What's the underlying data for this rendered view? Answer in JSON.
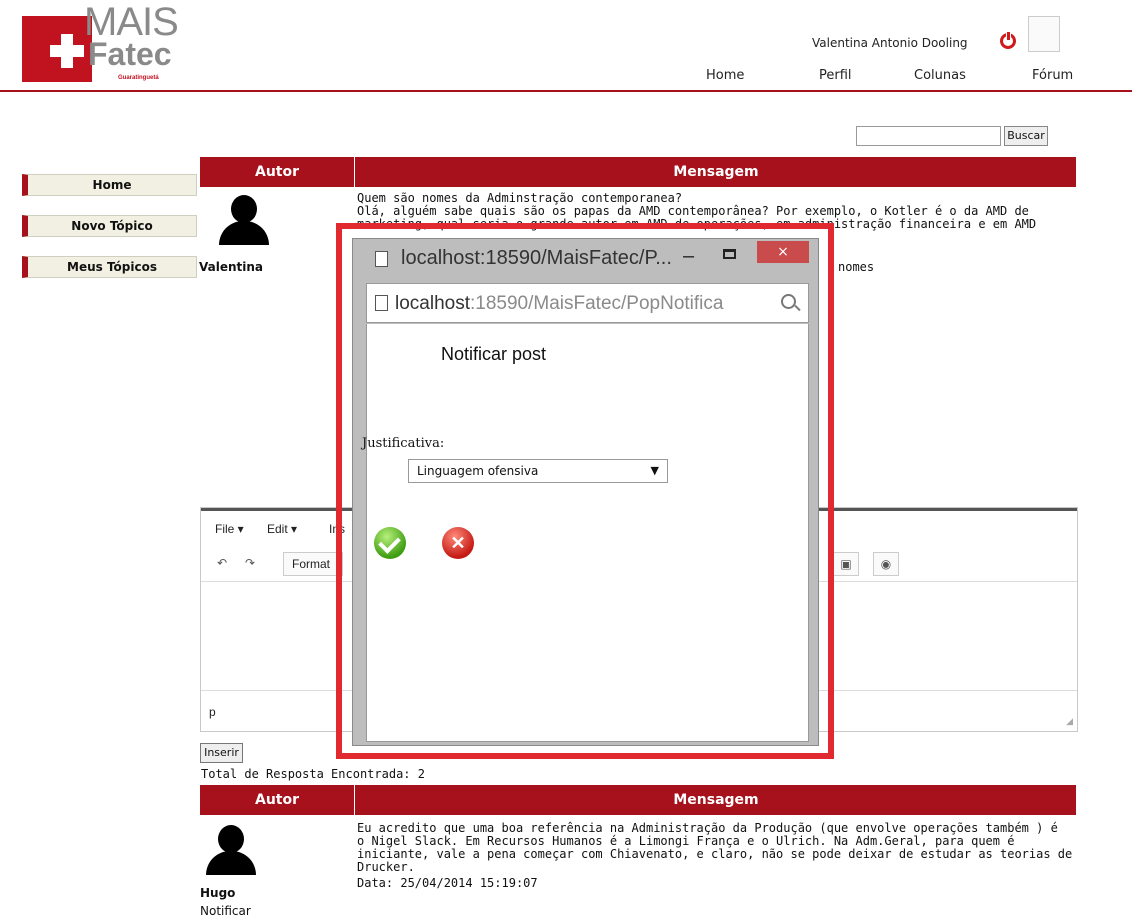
{
  "logo": {
    "mais": "MAIS",
    "fatec": "Fatec",
    "sub": "Guaratinguetá"
  },
  "user": {
    "name": "Valentina Antonio Dooling"
  },
  "nav": {
    "home": "Home",
    "perfil": "Perfil",
    "colunas": "Colunas",
    "forum": "Fórum"
  },
  "search": {
    "value": "",
    "button": "Buscar"
  },
  "sidebar": {
    "items": [
      {
        "label": "Home"
      },
      {
        "label": "Novo Tópico"
      },
      {
        "label": "Meus Tópicos"
      }
    ]
  },
  "table": {
    "author_header": "Autor",
    "message_header": "Mensagem"
  },
  "topic": {
    "author": "Valentina",
    "title": "Quem são nomes da Adminstração contemporanea?",
    "body_line1": "Olá, alguém sabe quais são os papas da AMD contemporânea? Por exemplo, o Kotler é o da AMD de",
    "body_line2": "marketing, qual seria o grande autor em AMD de operações, em administração financeira e em AMD",
    "visible_fragment": "nomes"
  },
  "editor": {
    "menu_file": "File",
    "menu_edit": "Edit",
    "menu_insert_fragment": "Ins",
    "format_label": "Format",
    "status_path": "p"
  },
  "insert_button": "Inserir",
  "total_responses": "Total de Resposta Encontrada: 2",
  "reply": {
    "author": "Hugo",
    "lines": [
      "Eu acredito que uma boa referência na Administração da Produção (que envolve operações também ) é",
      "o Nigel Slack. Em Recursos Humanos é a Limongi França e o Ulrich. Na Adm.Geral, para quem é",
      "iniciante, vale a pena começar com Chiavenato, e claro, não se pode deixar de estudar as teorias de",
      "Drucker."
    ],
    "date": "Data: 25/04/2014 15:19:07",
    "notify_link": "Notificar"
  },
  "popup": {
    "window_title": "localhost:18590/MaisFatec/P...",
    "address_host": "localhost",
    "address_rest": ":18590/MaisFatec/PopNotifica",
    "heading": "Notificar post",
    "justification_label": "Justificativa:",
    "justification_value": "Linguagem ofensiva",
    "close_glyph": "×",
    "minimize_glyph": "–"
  },
  "colors": {
    "brand_red": "#a6111c",
    "highlight_red": "#e02a2f"
  }
}
